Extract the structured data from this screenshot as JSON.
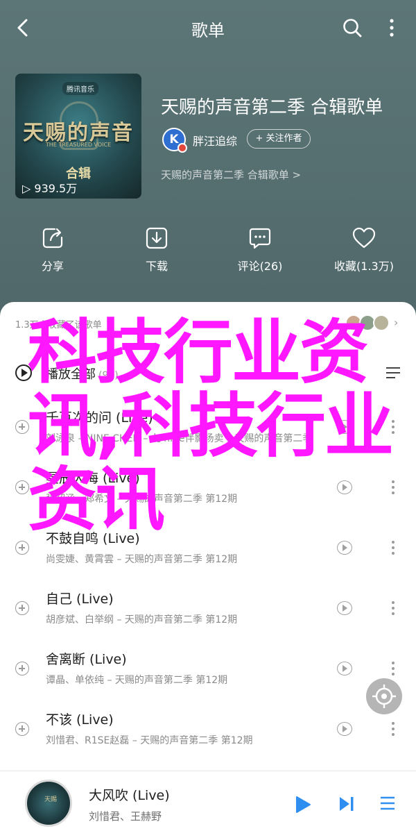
{
  "header": {
    "title": "歌单"
  },
  "album": {
    "cover_badge": "腾讯音乐",
    "cover_show_title": "天赐的声音",
    "cover_show_en": "THE TREASURED VOICE",
    "cover_tag": "合辑",
    "play_count": "939.5万",
    "title": "天赐的声音第二季 合辑歌单",
    "creator": "胖汪追综",
    "follow_label": "+ 关注作者",
    "description": "天赐的声音第二季 合辑歌单 >"
  },
  "actions": {
    "share": "分享",
    "download": "下载",
    "comment": "评论(26)",
    "favorite": "收藏(1.3万)"
  },
  "list": {
    "collect_text": "1.3万人收藏了该歌单",
    "play_all_label": "播放全部",
    "play_all_count": "(90)",
    "songs": [
      {
        "name": "千百次的问 (Live)",
        "meta": "刘泳泉 – NINE CHEN – 九 nine伴影杨卖 – 天赐的声音第二季"
      },
      {
        "name": "星辰大海 (Live)",
        "meta": "张韶涵、郑希文 – 天赐的声音第二季 第12期"
      },
      {
        "name": "不鼓自鸣 (Live)",
        "meta": "尚雯婕、黄霄雲 – 天赐的声音第二季 第12期"
      },
      {
        "name": "自己 (Live)",
        "meta": "胡彦斌、白举纲 – 天赐的声音第二季 第12期"
      },
      {
        "name": "舍离断 (Live)",
        "meta": "谭晶、单依纯 – 天赐的声音第二季 第12期"
      },
      {
        "name": "不该 (Live)",
        "meta": "刘惜君、R1SE赵磊 – 天赐的声音第二季 第12期"
      }
    ]
  },
  "player": {
    "disc_label": "天赐",
    "song_title": "大风吹 (Live)",
    "song_artist": "刘惜君、王赫野"
  },
  "overlay": {
    "text": "科技行业资讯,科技行业资讯"
  },
  "colors": {
    "header_bg": "#566f71",
    "overlay": "#ff17ff",
    "player_accent": "#2f8ff0"
  }
}
